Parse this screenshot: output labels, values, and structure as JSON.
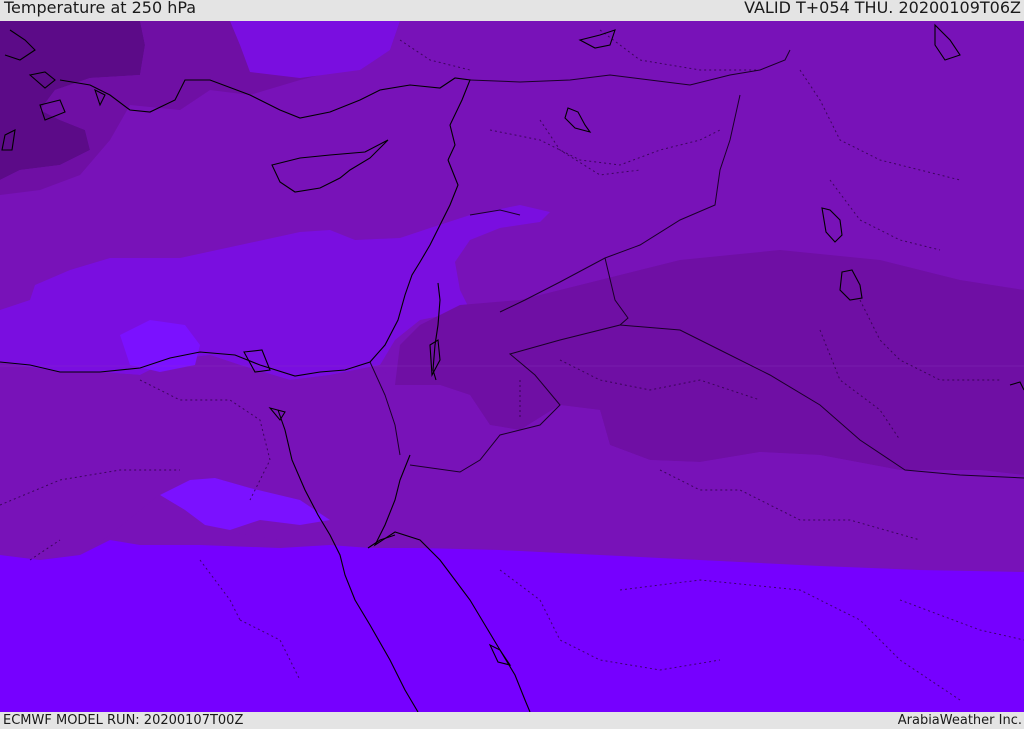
{
  "header": {
    "title": "Temperature at 250 hPa",
    "valid": "VALID T+054 THU. 20200109T06Z"
  },
  "footer": {
    "model_run": "ECMWF MODEL RUN: 20200107T00Z",
    "credit": "ArabiaWeather Inc."
  },
  "colors": {
    "band_coldest": "#5c0b88",
    "band_cold": "#6f0fa4",
    "band_mid": "#7812b8",
    "band_warm": "#7a0ee0",
    "band_warmest": "#7600ff",
    "band_highlight": "#7b11ff",
    "coastline": "#000000",
    "border": "#2a0040"
  }
}
